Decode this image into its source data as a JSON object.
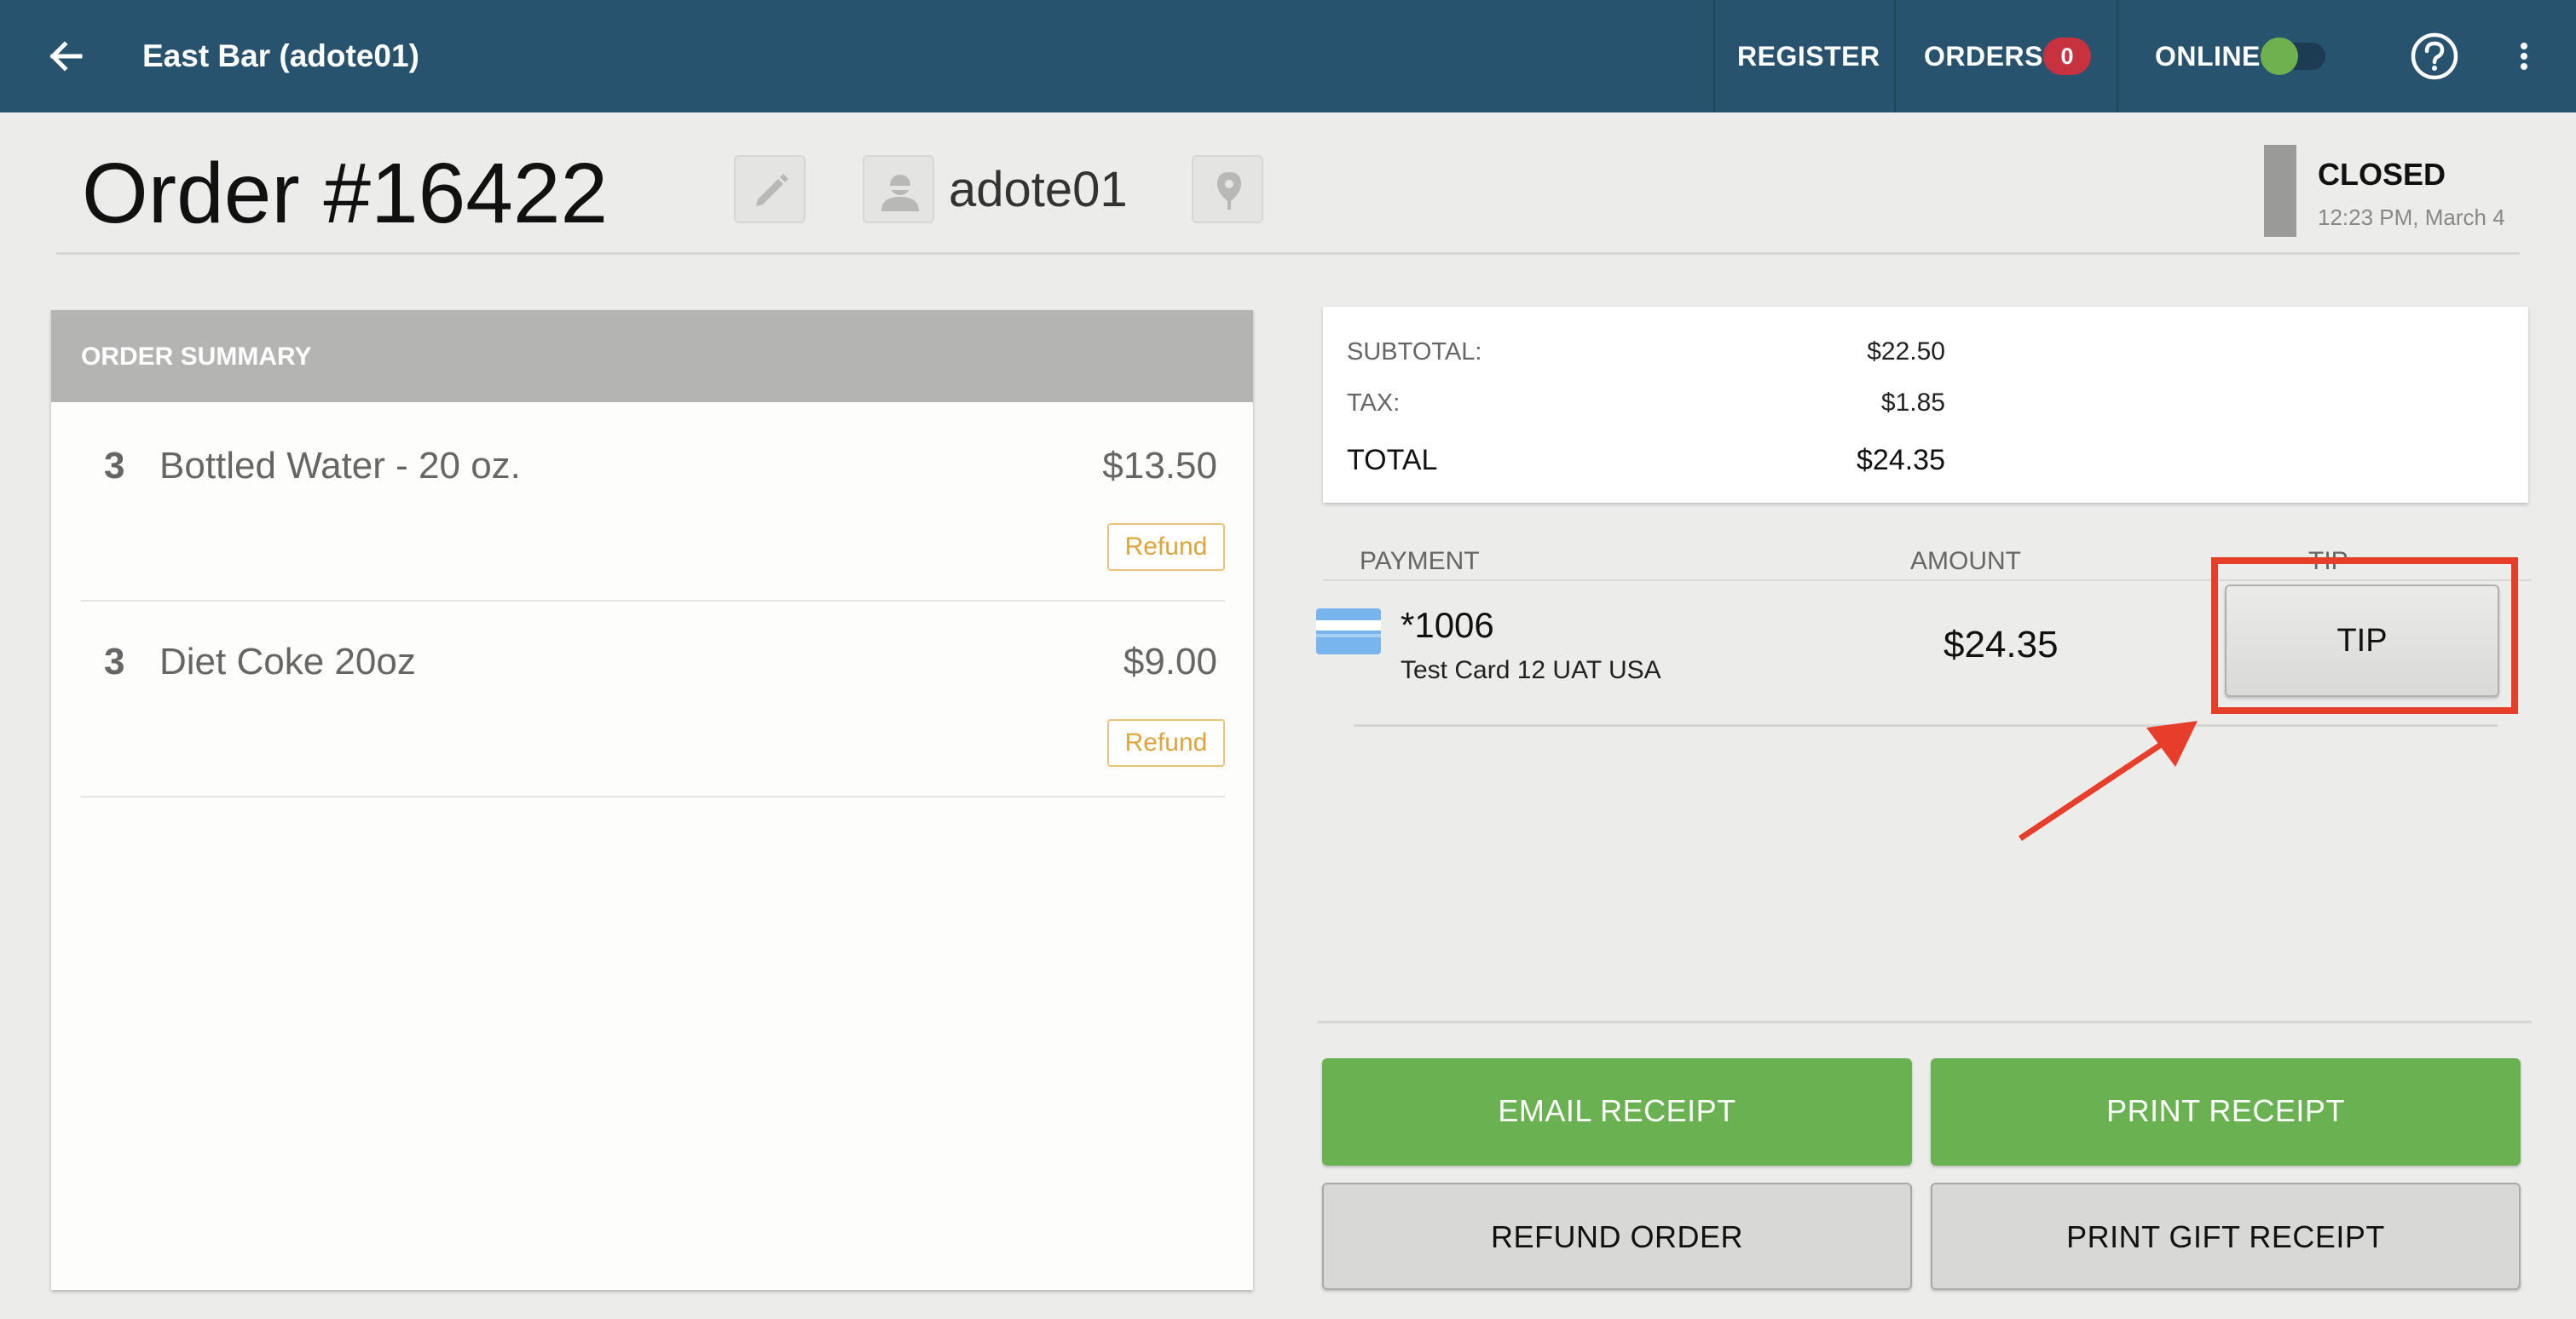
{
  "topbar": {
    "title": "East Bar (adote01)",
    "nav": {
      "register": "REGISTER",
      "orders": "ORDERS",
      "orders_count": "0",
      "online": "ONLINE"
    },
    "online_enabled": true,
    "icons": [
      "back-arrow-icon",
      "help-icon",
      "more-vert-icon"
    ]
  },
  "order": {
    "title": "Order #16422",
    "customer": "adote01",
    "status": "CLOSED",
    "status_time": "12:23 PM, March 4"
  },
  "summary": {
    "heading": "ORDER SUMMARY",
    "items": [
      {
        "qty": "3",
        "name": "Bottled Water - 20 oz.",
        "price": "$13.50",
        "action": "Refund"
      },
      {
        "qty": "3",
        "name": "Diet Coke 20oz",
        "price": "$9.00",
        "action": "Refund"
      }
    ]
  },
  "totals": {
    "subtotal_label": "SUBTOTAL:",
    "subtotal": "$22.50",
    "tax_label": "TAX:",
    "tax": "$1.85",
    "total_label": "TOTAL",
    "total": "$24.35"
  },
  "payments": {
    "headers": {
      "payment": "PAYMENT",
      "amount": "AMOUNT",
      "tip": "TIP"
    },
    "rows": [
      {
        "card_number": "*1006",
        "card_desc": "Test Card 12 UAT USA",
        "amount": "$24.35",
        "tip_button": "TIP"
      }
    ]
  },
  "actions": {
    "email_receipt": "EMAIL RECEIPT",
    "print_receipt": "PRINT RECEIPT",
    "refund_order": "REFUND ORDER",
    "print_gift_receipt": "PRINT GIFT RECEIPT"
  },
  "colors": {
    "topbar": "#27536f",
    "green_button": "#6ab152",
    "badge": "#c8323f",
    "highlight": "#e63e2a",
    "refund_outline": "#eac27a"
  }
}
